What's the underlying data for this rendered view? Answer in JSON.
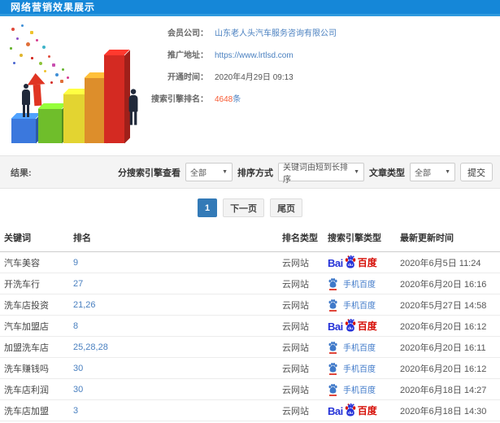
{
  "header": {
    "title": "网络营销效果展示"
  },
  "info": {
    "rows": [
      {
        "name": "member-company",
        "label": "会员公司：",
        "value": "山东老人头汽车服务咨询有限公司",
        "link": true
      },
      {
        "name": "promo-url",
        "label": "推广地址：",
        "value": "https://www.lrtlsd.com",
        "link": true
      },
      {
        "name": "open-time",
        "label": "开通时间：",
        "value": "2020年4月29日 09:13",
        "link": false
      },
      {
        "name": "engine-rank-count",
        "label": "搜索引擎排名：",
        "value": "4648",
        "suffix": "条",
        "link": false,
        "highlight": true
      }
    ]
  },
  "filters": {
    "result_label": "结果:",
    "engine_view_label": "分搜索引擎查看",
    "engine_view_value": "全部",
    "sort_label": "排序方式",
    "sort_value": "关键词由短到长排序",
    "article_type_label": "文章类型",
    "article_type_value": "全部",
    "submit_label": "提交",
    "caret_icon": "▼"
  },
  "pagination": {
    "current": "1",
    "next_label": "下一页",
    "last_label": "尾页"
  },
  "engines": {
    "baidu": {
      "prefix": "Bai",
      "suffix": "百度"
    },
    "mobile_baidu": {
      "label": "手机百度"
    }
  },
  "table": {
    "headers": [
      "关键词",
      "排名",
      "排名类型",
      "搜索引擎类型",
      "最新更新时间"
    ],
    "rows": [
      {
        "keyword": "汽车美容",
        "rank": "9",
        "rank_type": "云网站",
        "engine": "baidu",
        "updated": "2020年6月5日 11:24"
      },
      {
        "keyword": "开洗车行",
        "rank": "27",
        "rank_type": "云网站",
        "engine": "mobile-baidu",
        "updated": "2020年6月20日 16:16"
      },
      {
        "keyword": "洗车店投资",
        "rank": "21,26",
        "rank_type": "云网站",
        "engine": "mobile-baidu",
        "updated": "2020年5月27日 14:58"
      },
      {
        "keyword": "汽车加盟店",
        "rank": "8",
        "rank_type": "云网站",
        "engine": "baidu",
        "updated": "2020年6月20日 16:12"
      },
      {
        "keyword": "加盟洗车店",
        "rank": "25,28,28",
        "rank_type": "云网站",
        "engine": "mobile-baidu",
        "updated": "2020年6月20日 16:11"
      },
      {
        "keyword": "洗车赚钱吗",
        "rank": "30",
        "rank_type": "云网站",
        "engine": "mobile-baidu",
        "updated": "2020年6月20日 16:12"
      },
      {
        "keyword": "洗车店利润",
        "rank": "30",
        "rank_type": "云网站",
        "engine": "mobile-baidu",
        "updated": "2020年6月18日 14:27"
      },
      {
        "keyword": "洗车店加盟",
        "rank": "3",
        "rank_type": "云网站",
        "engine": "baidu",
        "updated": "2020年6月18日 14:30"
      }
    ]
  },
  "colors": {
    "header_bg": "#1587d8",
    "link_blue": "#4a80c0",
    "count_orange": "#f75b34",
    "page_active": "#337ab7",
    "baidu_blue": "#2633d8",
    "baidu_red": "#d60d05",
    "mobile_blue": "#3f79c9"
  }
}
